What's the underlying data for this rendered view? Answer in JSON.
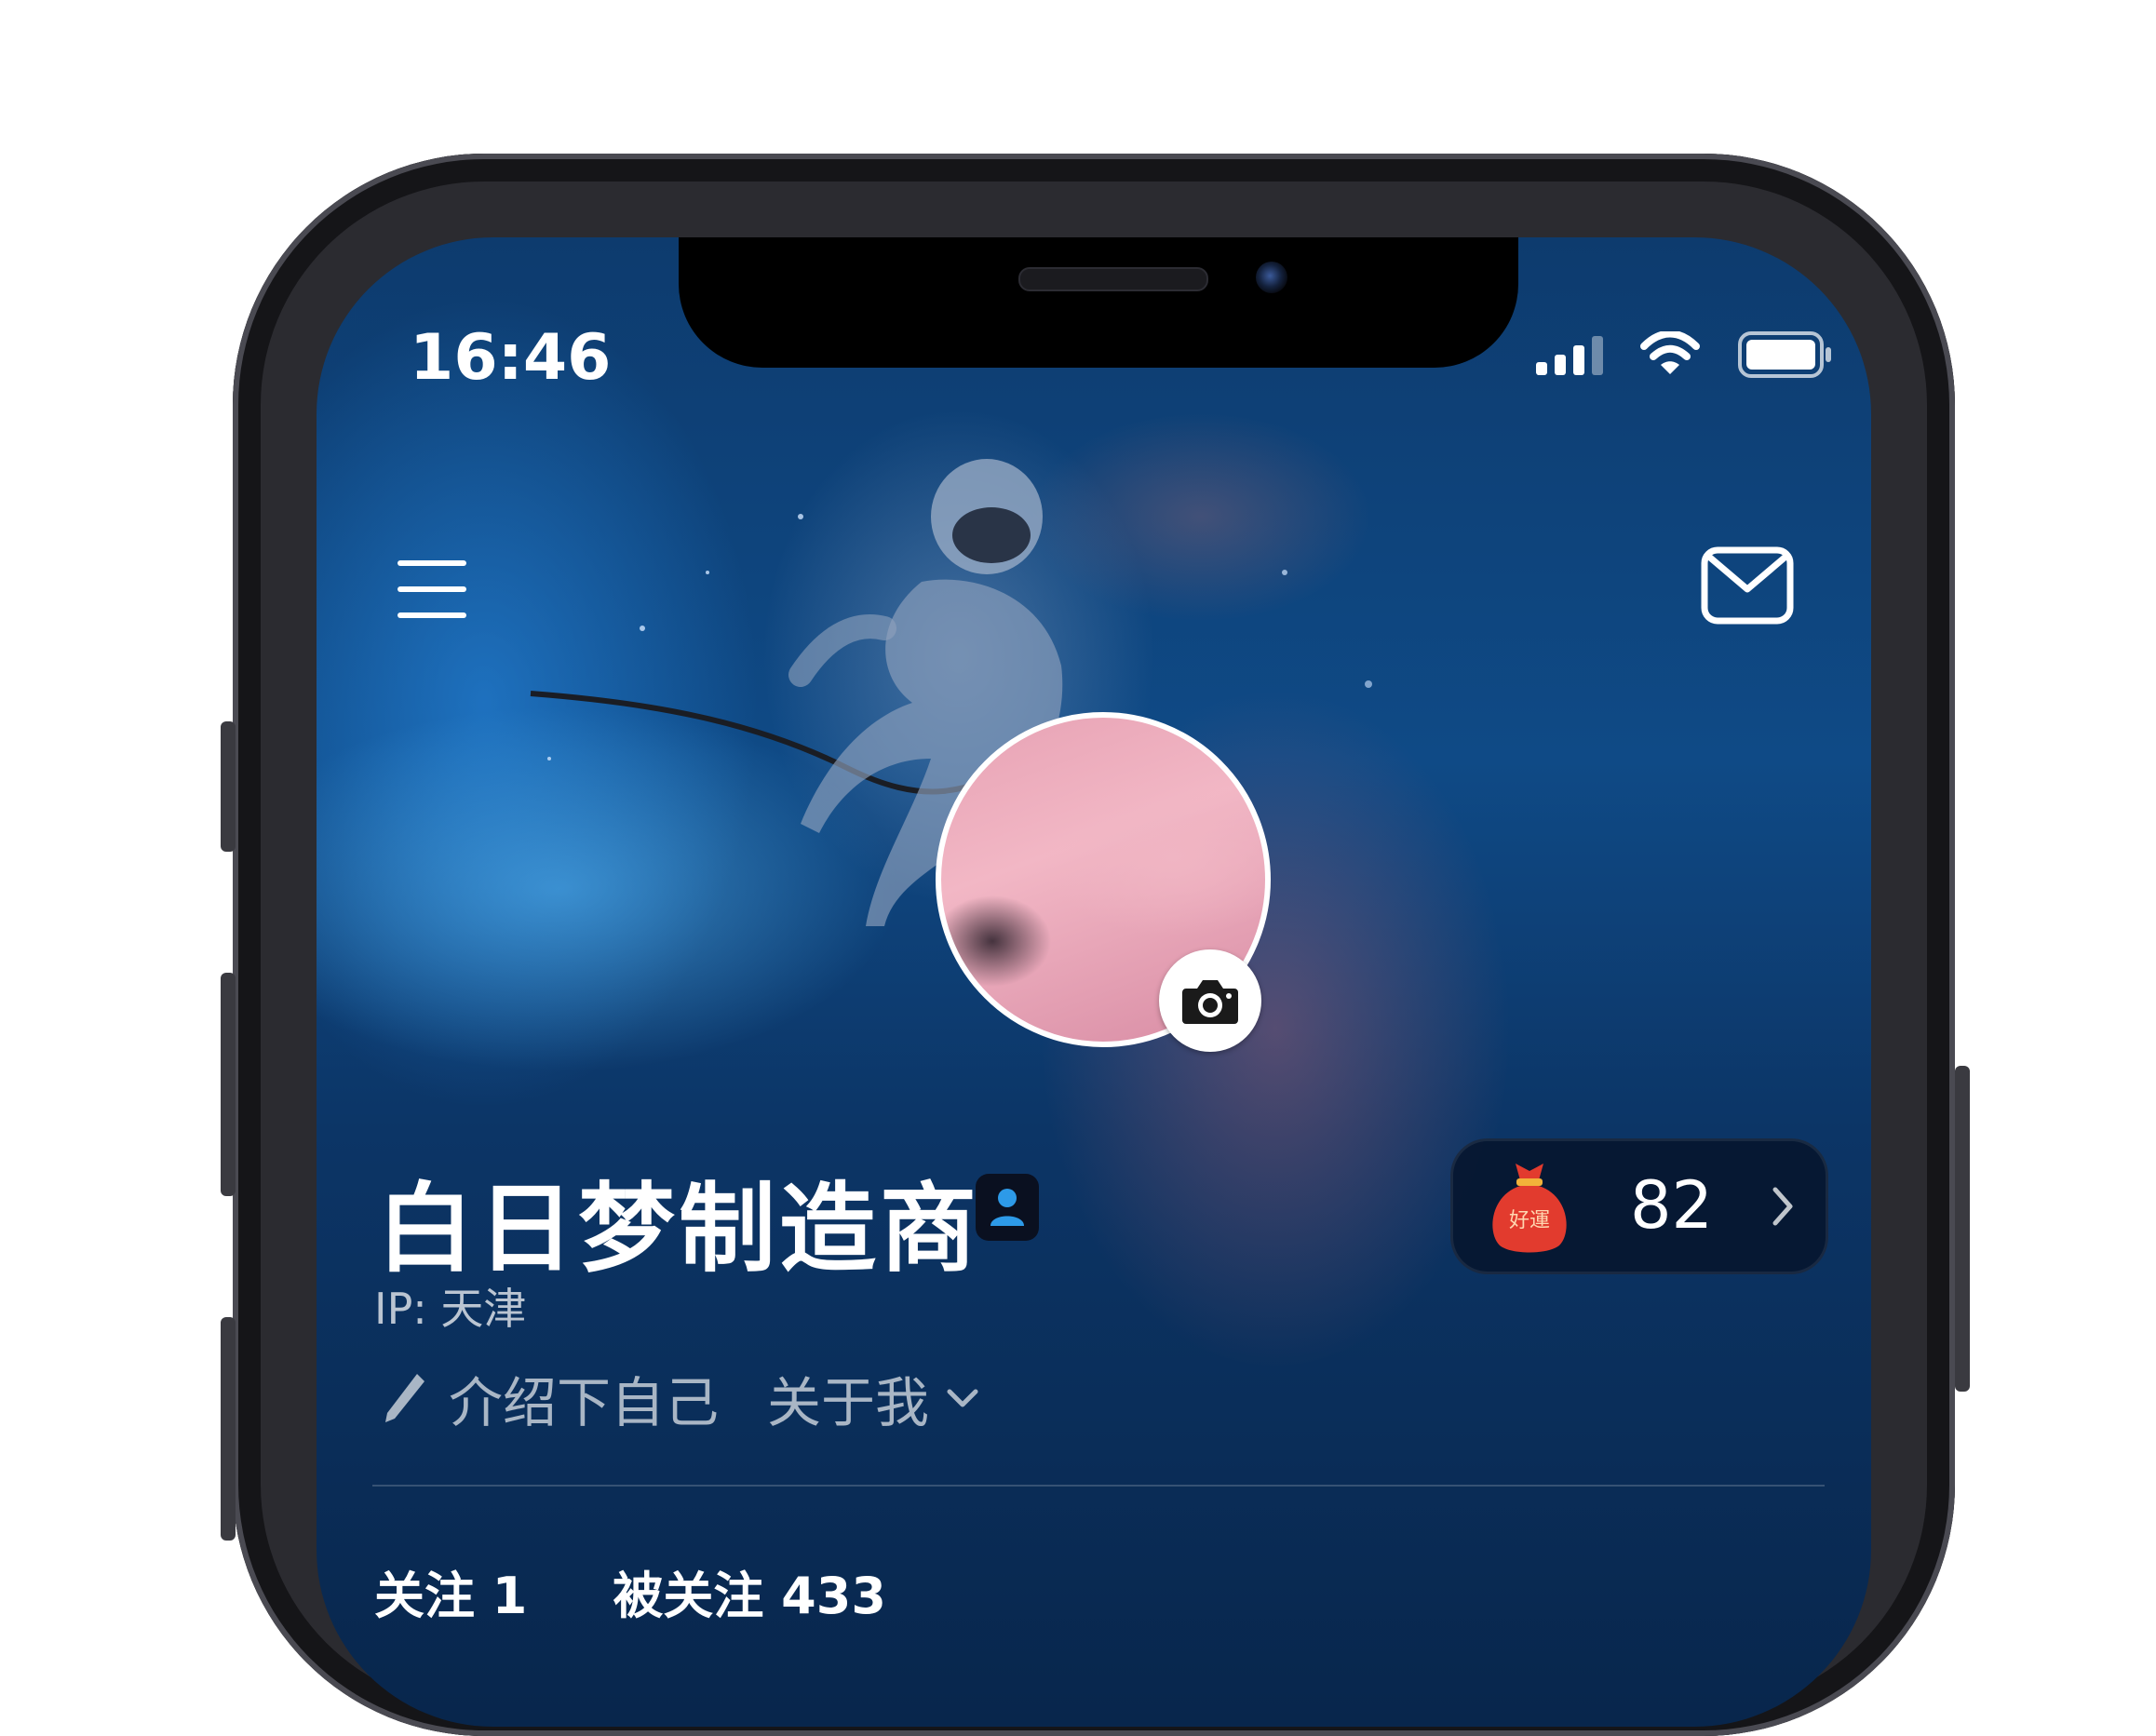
{
  "status_bar": {
    "time": "16:46",
    "icons": [
      "signal-icon",
      "wifi-icon",
      "battery-icon"
    ]
  },
  "header": {
    "menu_icon": "hamburger-menu-icon",
    "mail_icon": "mail-icon"
  },
  "profile": {
    "name": "白日梦制造商",
    "ip": "IP: 天津",
    "bio_placeholder": "介绍下自己",
    "about_label": "关于我",
    "avatar_badge_icon": "camera-icon",
    "verified_icon": "person-badge-icon"
  },
  "luck_card": {
    "bag_text": "好運",
    "value": "82",
    "icon": "chevron-right-icon"
  },
  "stats": {
    "following": "关注 1",
    "followers": "被关注 433"
  },
  "colors": {
    "accent_blue": "#1e8ce6",
    "bag_red": "#e23b2e",
    "background_deep": "#08264c"
  }
}
